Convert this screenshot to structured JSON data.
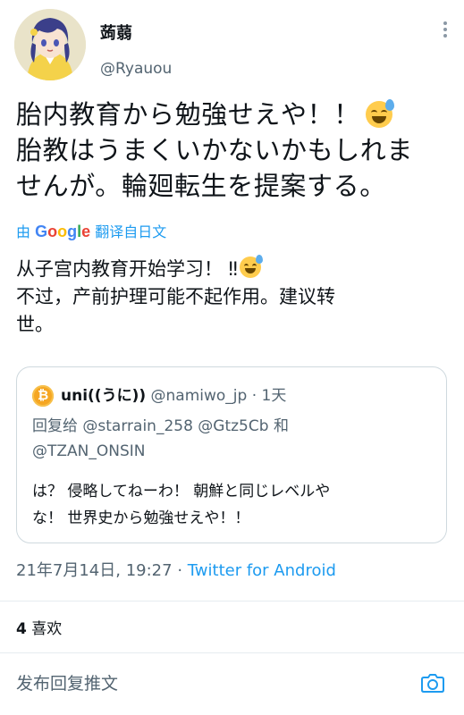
{
  "author": {
    "name": "蒟蒻",
    "handle": "@Ryauou"
  },
  "tweet": {
    "line1": "胎内教育から勉強せえや！！",
    "line2": "胎教はうまくいかないかもしれま",
    "line3": "せんが。輪廻転生を提案する。"
  },
  "translation": {
    "prefix": "由",
    "provider": "Google",
    "label": "翻译自日文",
    "line1": "从子宫内教育开始学习！ ‼",
    "line2": "不过，产前护理可能不起作用。建议转",
    "line3": "世。"
  },
  "quote": {
    "name": "uni((うに))",
    "handle": "@namiwo_jp",
    "separator": "·",
    "time": "1天",
    "reply_prefix": "回复给",
    "reply_user1": "@starrain_258",
    "reply_user2": "@Gtz5Cb",
    "reply_and": "和",
    "reply_user3": "@TZAN_ONSIN",
    "text_line1": "は？ 侵略してねーわ！ 朝鮮と同じレベルや",
    "text_line2": "な！ 世界史から勉強せえや！！"
  },
  "meta": {
    "date": "21年7月14日, 19:27",
    "separator": "·",
    "source": "Twitter for Android"
  },
  "stats": {
    "likes_count": "4",
    "likes_label": "喜欢"
  },
  "reply": {
    "placeholder": "发布回复推文"
  },
  "icons": {
    "avatar": "avatar",
    "more": "more-vertical-icon",
    "emoji": "sweat-smile-emoji",
    "camera": "camera-icon"
  },
  "colors": {
    "link": "#1d9bf0",
    "secondary_text": "#536471",
    "border": "#cfd9de"
  }
}
